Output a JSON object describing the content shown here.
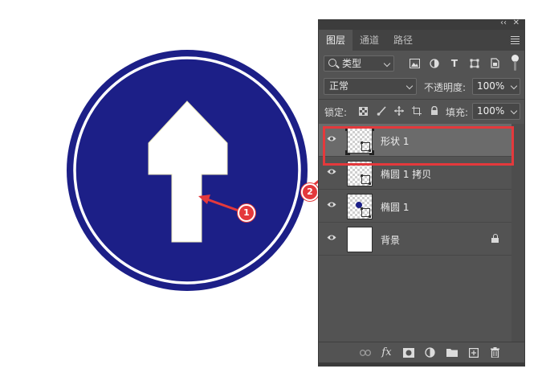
{
  "canvas": {
    "sign_outer_color": "#1c1f87",
    "sign_ring_color": "#ffffff",
    "arrow_color": "#ffffff"
  },
  "panel": {
    "tabs": [
      {
        "label": "图层",
        "active": true
      },
      {
        "label": "通道",
        "active": false
      },
      {
        "label": "路径",
        "active": false
      }
    ],
    "filter": {
      "kind_label": "类型"
    },
    "blend_mode": "正常",
    "opacity_label": "不透明度:",
    "opacity_value": "100%",
    "lock_label": "锁定:",
    "fill_label": "填充:",
    "fill_value": "100%",
    "layers": [
      {
        "name": "形状 1",
        "selected": true,
        "visible": true,
        "thumb": "shape",
        "locked": false
      },
      {
        "name": "椭圆 1 拷贝",
        "selected": false,
        "visible": true,
        "thumb": "shape",
        "locked": false
      },
      {
        "name": "椭圆 1",
        "selected": false,
        "visible": true,
        "thumb": "ellipse",
        "locked": false
      },
      {
        "name": "背景",
        "selected": false,
        "visible": true,
        "thumb": "white",
        "locked": true
      }
    ],
    "footer_icons": [
      "link-icon",
      "fx-icon",
      "mask-icon",
      "adjustment-icon",
      "folder-icon",
      "new-layer-icon",
      "trash-icon"
    ]
  },
  "annotations": {
    "callout_1": "1",
    "callout_2": "2",
    "accent_color": "#e4393c"
  }
}
